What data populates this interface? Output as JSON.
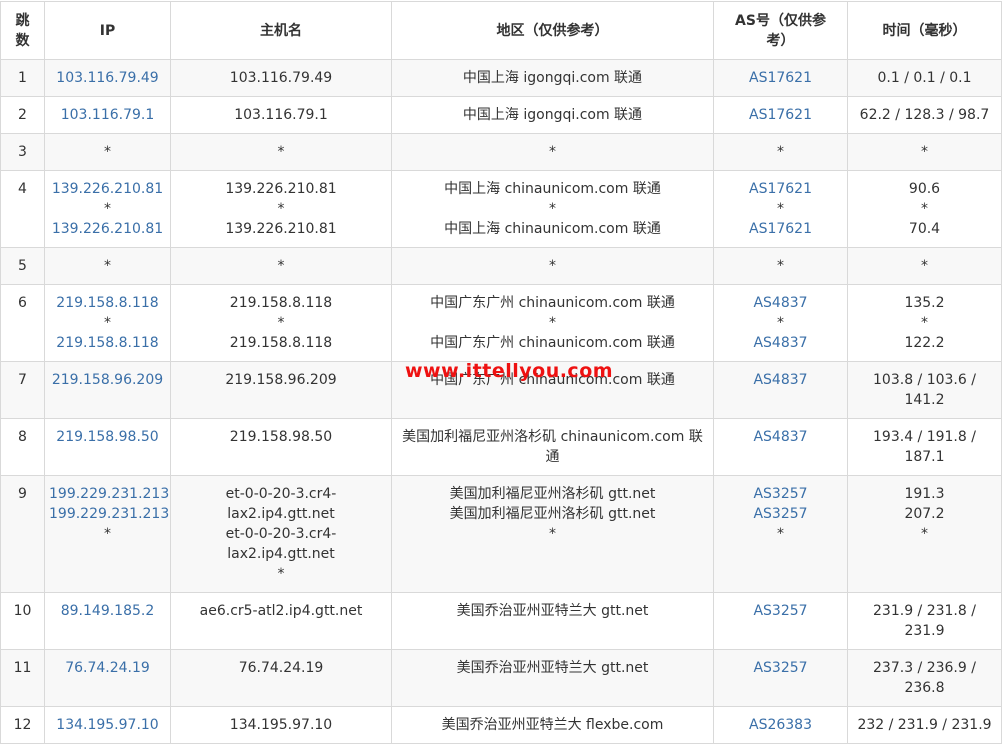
{
  "headers": {
    "hop": "跳数",
    "ip": "IP",
    "host": "主机名",
    "region": "地区（仅供参考）",
    "as": "AS号（仅供参考）",
    "time": "时间（毫秒）"
  },
  "rows": [
    {
      "hop": "1",
      "ip": [
        "103.116.79.49"
      ],
      "host": [
        "103.116.79.49"
      ],
      "region": [
        "中国上海 igongqi.com 联通"
      ],
      "as": [
        "AS17621"
      ],
      "time": [
        "0.1 / 0.1 / 0.1"
      ]
    },
    {
      "hop": "2",
      "ip": [
        "103.116.79.1"
      ],
      "host": [
        "103.116.79.1"
      ],
      "region": [
        "中国上海 igongqi.com 联通"
      ],
      "as": [
        "AS17621"
      ],
      "time": [
        "62.2 / 128.3 / 98.7"
      ]
    },
    {
      "hop": "3",
      "ip": [
        "*"
      ],
      "host": [
        "*"
      ],
      "region": [
        "*"
      ],
      "as": [
        "*"
      ],
      "time": [
        "*"
      ]
    },
    {
      "hop": "4",
      "ip": [
        "139.226.210.81",
        "*",
        "139.226.210.81"
      ],
      "host": [
        "139.226.210.81",
        "*",
        "139.226.210.81"
      ],
      "region": [
        "中国上海 chinaunicom.com 联通",
        "*",
        "中国上海 chinaunicom.com 联通"
      ],
      "as": [
        "AS17621",
        "*",
        "AS17621"
      ],
      "time": [
        "90.6",
        "*",
        "70.4"
      ]
    },
    {
      "hop": "5",
      "ip": [
        "*"
      ],
      "host": [
        "*"
      ],
      "region": [
        "*"
      ],
      "as": [
        "*"
      ],
      "time": [
        "*"
      ]
    },
    {
      "hop": "6",
      "ip": [
        "219.158.8.118",
        "*",
        "219.158.8.118"
      ],
      "host": [
        "219.158.8.118",
        "*",
        "219.158.8.118"
      ],
      "region": [
        "中国广东广州 chinaunicom.com 联通",
        "*",
        "中国广东广州 chinaunicom.com 联通"
      ],
      "as": [
        "AS4837",
        "*",
        "AS4837"
      ],
      "time": [
        "135.2",
        "*",
        "122.2"
      ]
    },
    {
      "hop": "7",
      "ip": [
        "219.158.96.209"
      ],
      "host": [
        "219.158.96.209"
      ],
      "region": [
        "中国广东广州 chinaunicom.com 联通"
      ],
      "as": [
        "AS4837"
      ],
      "time": [
        "103.8 / 103.6 /",
        "141.2"
      ]
    },
    {
      "hop": "8",
      "ip": [
        "219.158.98.50"
      ],
      "host": [
        "219.158.98.50"
      ],
      "region": [
        "美国加利福尼亚州洛杉矶 chinaunicom.com 联",
        "通"
      ],
      "as": [
        "AS4837"
      ],
      "time": [
        "193.4 / 191.8 /",
        "187.1"
      ]
    },
    {
      "hop": "9",
      "ip": [
        "199.229.231.213",
        "199.229.231.213",
        "*"
      ],
      "host": [
        "et-0-0-20-3.cr4-",
        "lax2.ip4.gtt.net",
        "et-0-0-20-3.cr4-",
        "lax2.ip4.gtt.net",
        "*"
      ],
      "region": [
        "美国加利福尼亚州洛杉矶 gtt.net",
        "美国加利福尼亚州洛杉矶 gtt.net",
        "*"
      ],
      "as": [
        "AS3257",
        "AS3257",
        "*"
      ],
      "time": [
        "191.3",
        "207.2",
        "*"
      ]
    },
    {
      "hop": "10",
      "ip": [
        "89.149.185.2"
      ],
      "host": [
        "ae6.cr5-atl2.ip4.gtt.net"
      ],
      "region": [
        "美国乔治亚州亚特兰大 gtt.net"
      ],
      "as": [
        "AS3257"
      ],
      "time": [
        "231.9 / 231.8 /",
        "231.9"
      ]
    },
    {
      "hop": "11",
      "ip": [
        "76.74.24.19"
      ],
      "host": [
        "76.74.24.19"
      ],
      "region": [
        "美国乔治亚州亚特兰大 gtt.net"
      ],
      "as": [
        "AS3257"
      ],
      "time": [
        "237.3 / 236.9 /",
        "236.8"
      ]
    },
    {
      "hop": "12",
      "ip": [
        "134.195.97.10"
      ],
      "host": [
        "134.195.97.10"
      ],
      "region": [
        "美国乔治亚州亚特兰大 flexbe.com"
      ],
      "as": [
        "AS26383"
      ],
      "time": [
        "232 / 231.9 / 231.9"
      ]
    }
  ],
  "watermark": "www.ittellyou.com"
}
